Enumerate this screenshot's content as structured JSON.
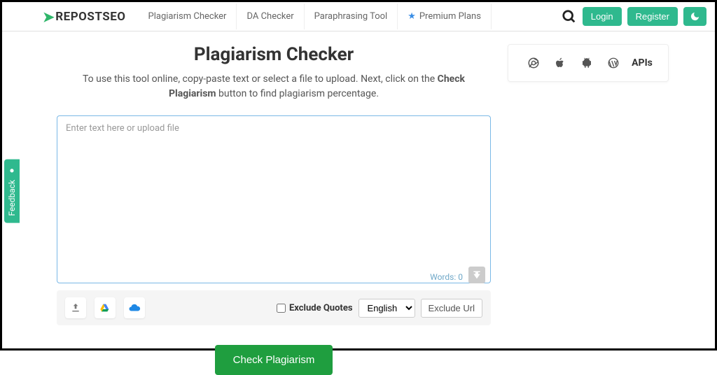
{
  "logo": {
    "text": "REPOSTSEO"
  },
  "nav": {
    "items": [
      "Plagiarism Checker",
      "DA Checker",
      "Paraphrasing Tool"
    ],
    "premium": "Premium Plans"
  },
  "auth": {
    "login": "Login",
    "register": "Register"
  },
  "page": {
    "title": "Plagiarism Checker",
    "subtitle_pre": "To use this tool online, copy-paste text or select a file to upload. Next, click on the ",
    "subtitle_bold": "Check Plagiarism",
    "subtitle_post": " button to find plagiarism percentage."
  },
  "editor": {
    "placeholder": "Enter text here or upload file",
    "wordcount_label": "Words:",
    "wordcount_value": "0"
  },
  "toolbar": {
    "exclude_quotes": "Exclude Quotes",
    "language": "English",
    "exclude_url": "Exclude Url"
  },
  "action": {
    "check": "Check Plagiarism"
  },
  "sidebar": {
    "apis": "APIs"
  },
  "feedback": {
    "label": "Feedback"
  }
}
